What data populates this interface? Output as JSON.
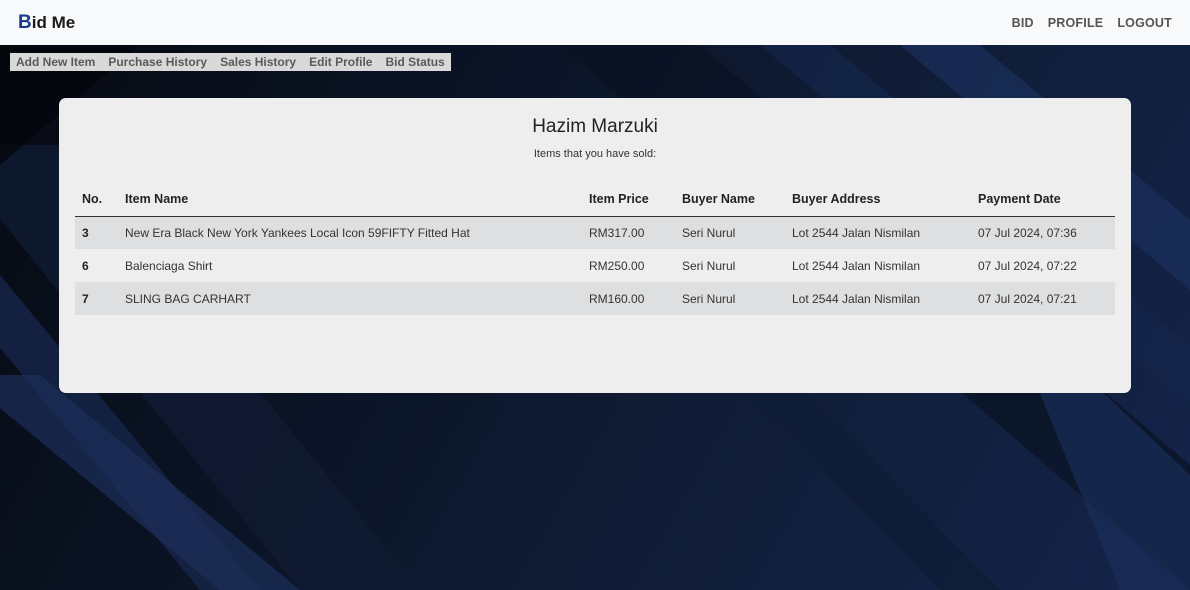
{
  "brand": {
    "initial": "B",
    "rest": "id Me"
  },
  "topnav": [
    "BID",
    "PROFILE",
    "LOGOUT"
  ],
  "submenu": [
    "Add New Item",
    "Purchase History",
    "Sales History",
    "Edit Profile",
    "Bid Status"
  ],
  "card": {
    "title": "Hazim Marzuki",
    "subtitle": "Items that you have sold:"
  },
  "table": {
    "headers": [
      "No.",
      "Item Name",
      "Item Price",
      "Buyer Name",
      "Buyer Address",
      "Payment Date"
    ],
    "rows": [
      [
        "3",
        "New Era Black New York Yankees Local Icon 59FIFTY Fitted Hat",
        "RM317.00",
        "Seri Nurul",
        "Lot 2544 Jalan Nismilan",
        "07 Jul 2024, 07:36"
      ],
      [
        "6",
        "Balenciaga Shirt",
        "RM250.00",
        "Seri Nurul",
        "Lot 2544 Jalan Nismilan",
        "07 Jul 2024, 07:22"
      ],
      [
        "7",
        "SLING BAG CARHART",
        "RM160.00",
        "Seri Nurul",
        "Lot 2544 Jalan Nismilan",
        "07 Jul 2024, 07:21"
      ]
    ]
  },
  "colors": {
    "brand_initial": "#1b3a8a",
    "background": "#0b1426",
    "card": "#eeeeef"
  }
}
